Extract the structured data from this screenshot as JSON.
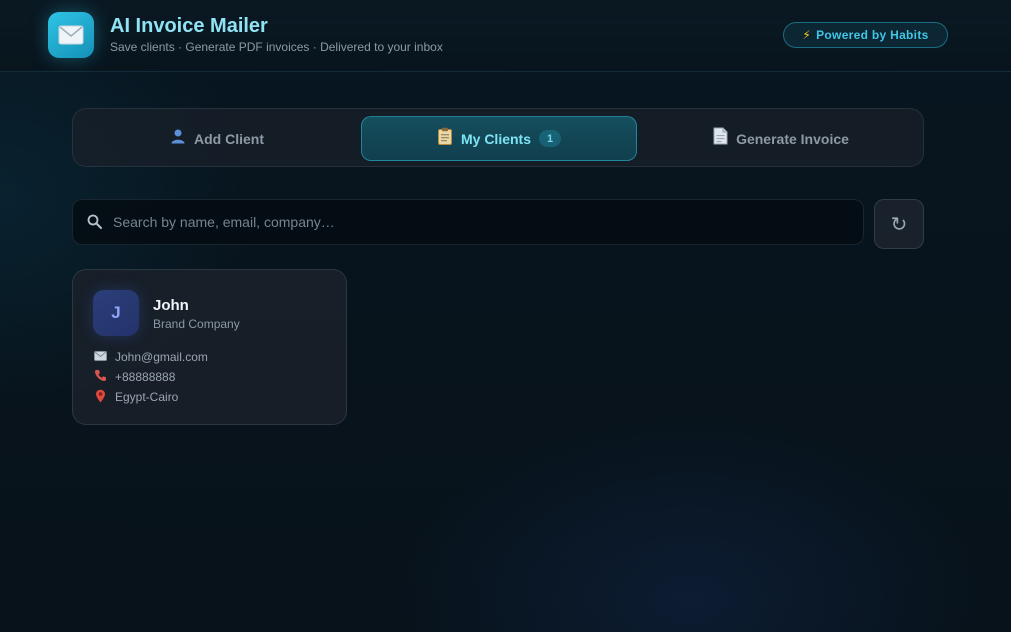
{
  "header": {
    "app_icon": "envelope-icon",
    "title": "AI Invoice Mailer",
    "subtitle": "Save clients · Generate PDF invoices · Delivered to your inbox",
    "badge": "Powered by Habits"
  },
  "tabs": [
    {
      "icon": "user-icon",
      "label": "Add Client",
      "active": false
    },
    {
      "icon": "clipboard-icon",
      "label": "My Clients",
      "count": "1",
      "active": true
    },
    {
      "icon": "document-icon",
      "label": "Generate Invoice",
      "active": false
    }
  ],
  "search": {
    "placeholder": "Search by name, email, company…",
    "value": ""
  },
  "refresh_icon": "refresh-icon",
  "clients": [
    {
      "initial": "J",
      "name": "John",
      "company": "Brand Company",
      "email": "John@gmail.com",
      "phone": "+88888888",
      "location": "Egypt-Cairo"
    }
  ],
  "colors": {
    "accent": "#2ec4e6",
    "background": "#07121a",
    "avatar": "#2b3f7a",
    "badge_bolt": "#f5c518"
  }
}
